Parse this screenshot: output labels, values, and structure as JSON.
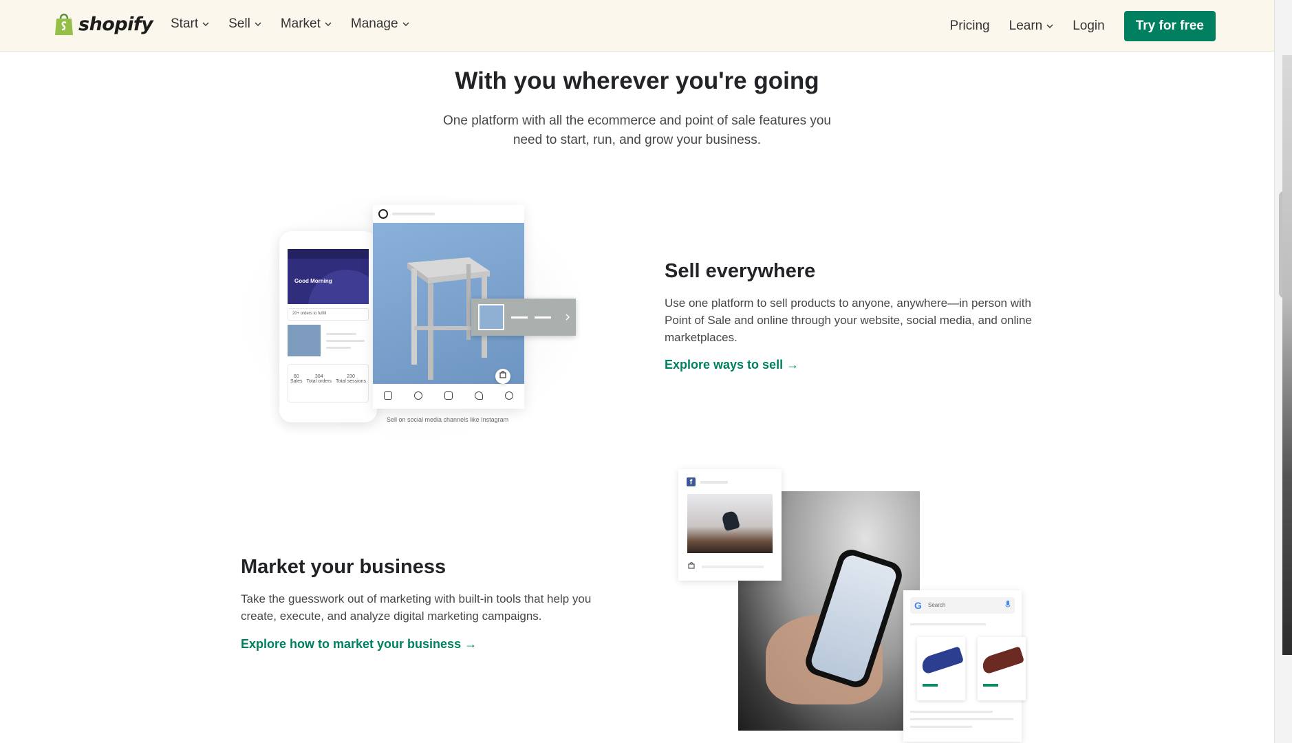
{
  "header": {
    "logo_text": "shopify",
    "nav": [
      {
        "label": "Start"
      },
      {
        "label": "Sell"
      },
      {
        "label": "Market"
      },
      {
        "label": "Manage"
      }
    ],
    "right": {
      "pricing": "Pricing",
      "learn": "Learn",
      "login": "Login",
      "cta": "Try for free"
    }
  },
  "intro": {
    "title": "With you wherever you're going",
    "subtitle": "One platform with all the ecommerce and point of sale features you need to start, run, and grow your business."
  },
  "sell": {
    "title": "Sell everywhere",
    "body": "Use one platform to sell products to anyone, anywhere—in person with Point of Sale and online through your website, social media, and online marketplaces.",
    "link": "Explore ways to sell →",
    "illustration": {
      "greeting": "Good Morning",
      "orders_note": "20+ orders to fulfill",
      "stats": [
        "60",
        "304",
        "230"
      ],
      "stat_labels": [
        "Sales",
        "Total orders",
        "Total sessions"
      ],
      "caption": "Sell on social media channels like Instagram"
    }
  },
  "market": {
    "title": "Market your business",
    "body": "Take the guesswork out of marketing with built-in tools that help you create, execute, and analyze digital marketing campaigns.",
    "link": "Explore how to market your business →",
    "illustration": {
      "search_placeholder": "Search",
      "shoe_colors": [
        "#2c3e8f",
        "#6b2a22"
      ]
    }
  },
  "colors": {
    "brand_green": "#008060",
    "header_bg": "#fbf7ed",
    "logo_green": "#95bf47"
  }
}
